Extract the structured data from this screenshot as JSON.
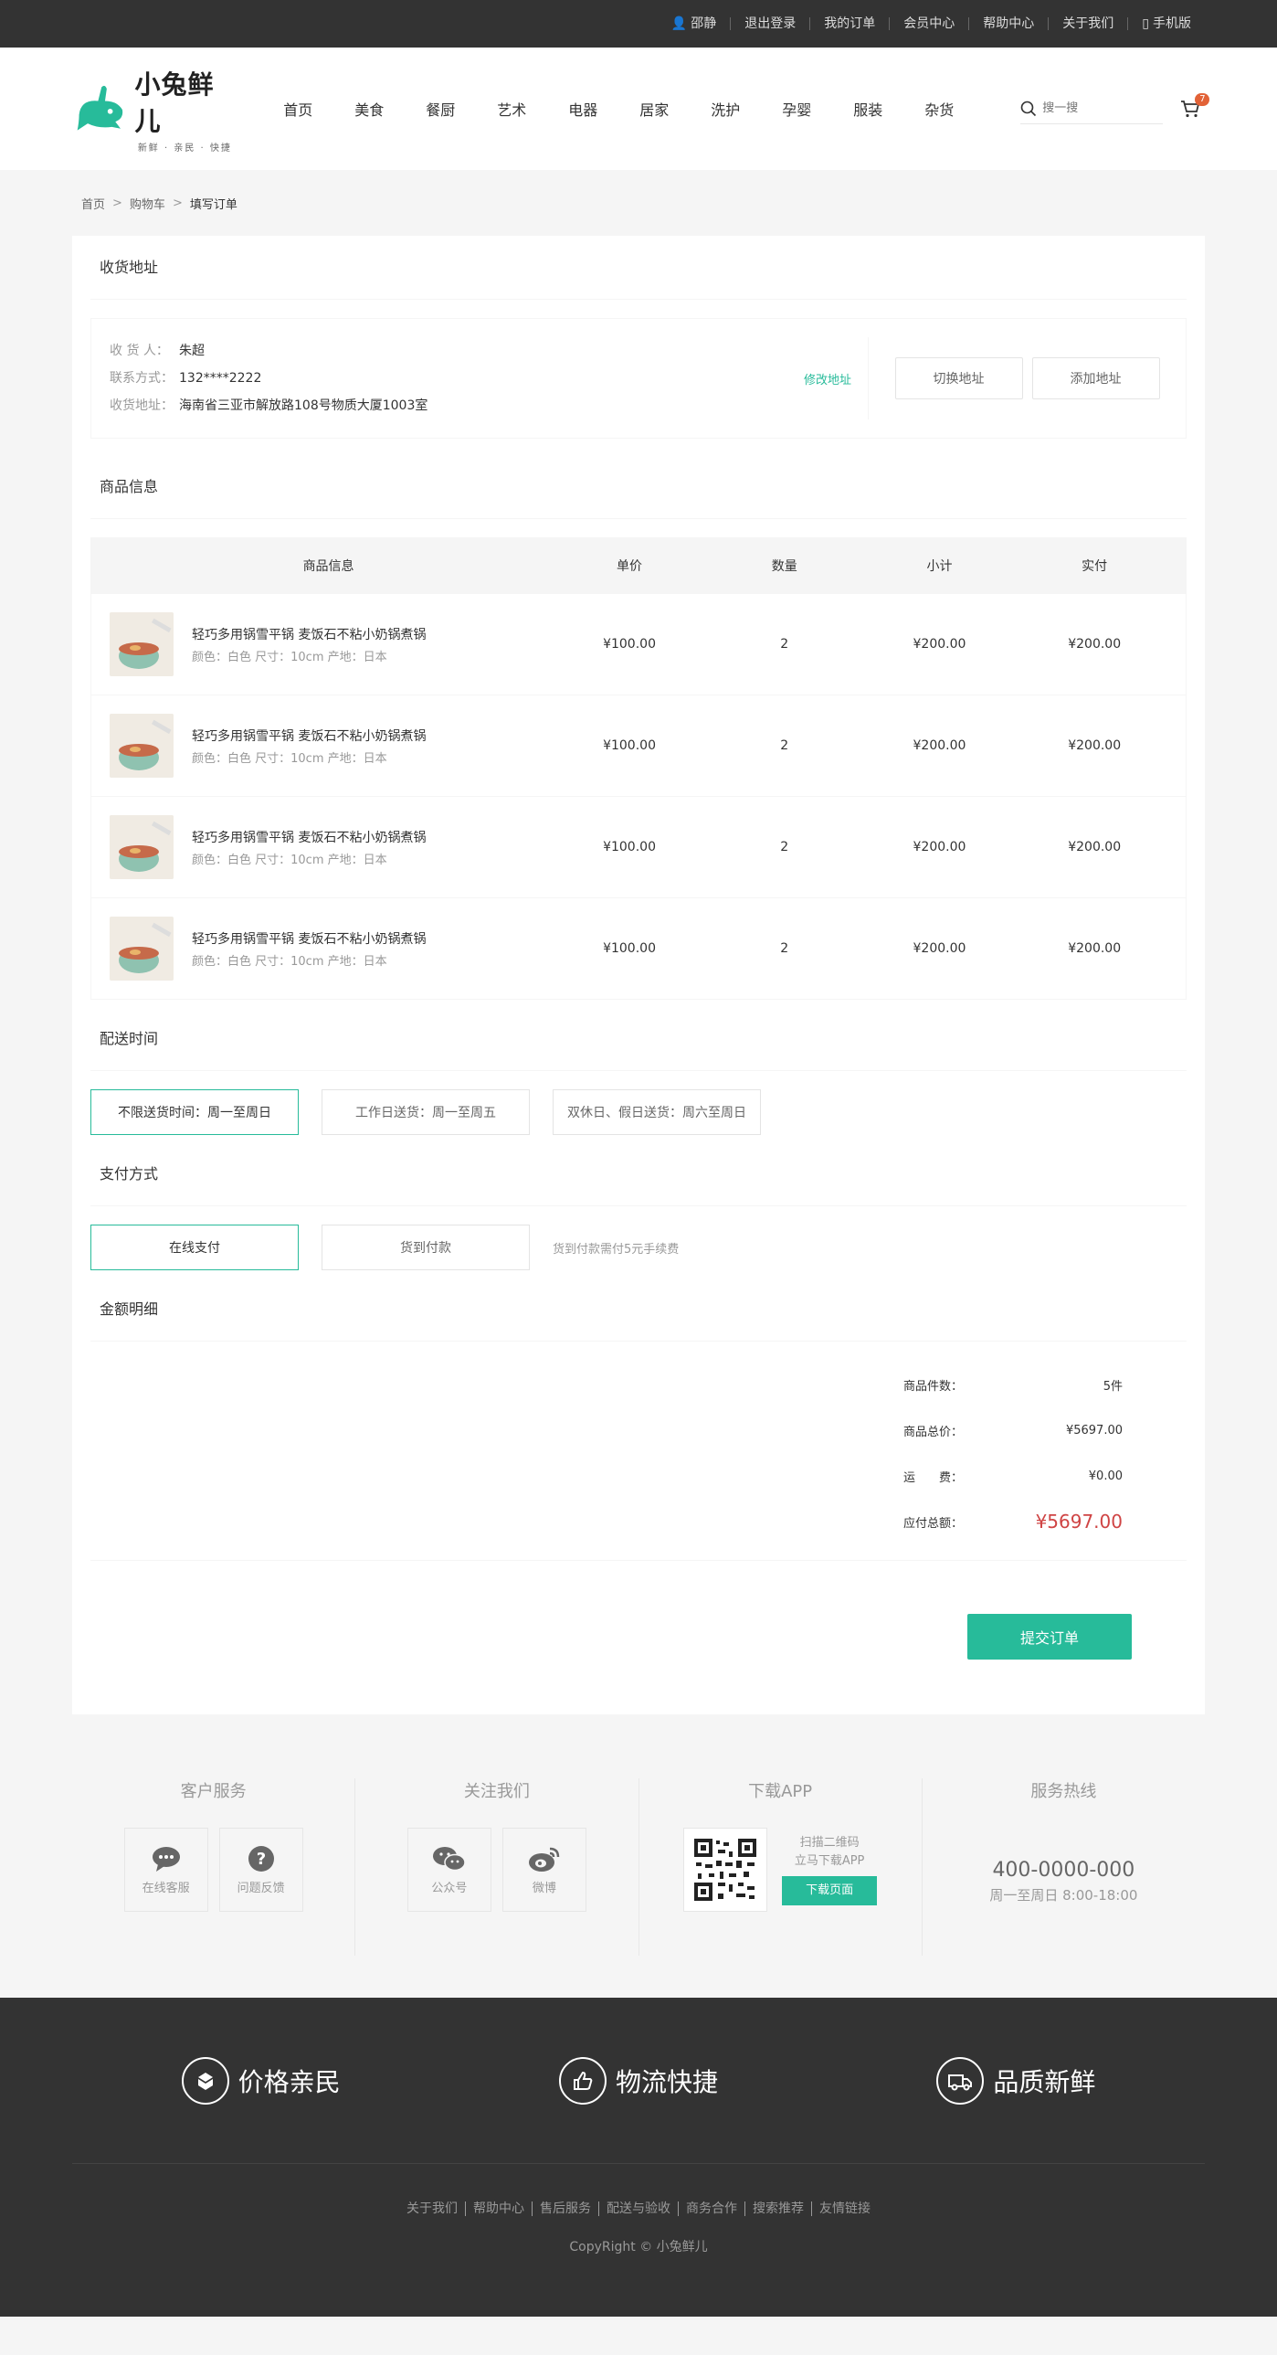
{
  "topbar": {
    "user": "邵静",
    "logout": "退出登录",
    "orders": "我的订单",
    "member": "会员中心",
    "help": "帮助中心",
    "about": "关于我们",
    "mobile": "手机版"
  },
  "logo": {
    "name": "小兔鲜儿",
    "slogan": "新鲜 · 亲民 · 快捷"
  },
  "nav": [
    "首页",
    "美食",
    "餐厨",
    "艺术",
    "电器",
    "居家",
    "洗护",
    "孕婴",
    "服装",
    "杂货"
  ],
  "search": {
    "placeholder": "搜一搜"
  },
  "cart": {
    "count": "7"
  },
  "breadcrumb": {
    "home": "首页",
    "cart": "购物车",
    "current": "填写订单"
  },
  "address": {
    "title": "收货地址",
    "receiver_label": "收 货 人：",
    "receiver": "朱超",
    "phone_label": "联系方式：",
    "phone": "132****2222",
    "addr_label": "收货地址：",
    "addr": "海南省三亚市解放路108号物质大厦1003室",
    "modify": "修改地址",
    "switch_btn": "切换地址",
    "add_btn": "添加地址"
  },
  "goods": {
    "title": "商品信息",
    "headers": [
      "商品信息",
      "单价",
      "数量",
      "小计",
      "实付"
    ],
    "rows": [
      {
        "name": "轻巧多用锅雪平锅 麦饭石不粘小奶锅煮锅",
        "attr": "颜色：白色 尺寸：10cm 产地：日本",
        "price": "¥100.00",
        "qty": "2",
        "subtotal": "¥200.00",
        "paid": "¥200.00"
      },
      {
        "name": "轻巧多用锅雪平锅 麦饭石不粘小奶锅煮锅",
        "attr": "颜色：白色 尺寸：10cm 产地：日本",
        "price": "¥100.00",
        "qty": "2",
        "subtotal": "¥200.00",
        "paid": "¥200.00"
      },
      {
        "name": "轻巧多用锅雪平锅 麦饭石不粘小奶锅煮锅",
        "attr": "颜色：白色 尺寸：10cm 产地：日本",
        "price": "¥100.00",
        "qty": "2",
        "subtotal": "¥200.00",
        "paid": "¥200.00"
      },
      {
        "name": "轻巧多用锅雪平锅 麦饭石不粘小奶锅煮锅",
        "attr": "颜色：白色 尺寸：10cm 产地：日本",
        "price": "¥100.00",
        "qty": "2",
        "subtotal": "¥200.00",
        "paid": "¥200.00"
      }
    ]
  },
  "delivery": {
    "title": "配送时间",
    "options": [
      "不限送货时间：周一至周日",
      "工作日送货：周一至周五",
      "双休日、假日送货：周六至周日"
    ]
  },
  "payment": {
    "title": "支付方式",
    "options": [
      "在线支付",
      "货到付款"
    ],
    "tip": "货到付款需付5元手续费"
  },
  "amount": {
    "title": "金额明细",
    "count_label": "商品件数：",
    "count": "5件",
    "total_label": "商品总价：",
    "total": "¥5697.00",
    "freight_label": "运　　费：",
    "freight": "¥0.00",
    "pay_label": "应付总额：",
    "pay": "¥5697.00"
  },
  "submit": "提交订单",
  "service": {
    "customer_title": "客户服务",
    "online": "在线客服",
    "feedback": "问题反馈",
    "follow_title": "关注我们",
    "wechat": "公众号",
    "weibo": "微博",
    "app_title": "下载APP",
    "scan": "扫描二维码",
    "scan2": "立马下载APP",
    "download": "下载页面",
    "hotline_title": "服务热线",
    "phone": "400-0000-000",
    "hours": "周一至周日 8:00-18:00"
  },
  "footer": {
    "features": [
      "价格亲民",
      "物流快捷",
      "品质新鲜"
    ],
    "links": [
      "关于我们",
      "帮助中心",
      "售后服务",
      "配送与验收",
      "商务合作",
      "搜索推荐",
      "友情链接"
    ],
    "copyright": "CopyRight © 小兔鲜儿"
  },
  "colors": {
    "accent": "#27bb9a",
    "price_red": "#cf4444",
    "dark": "#333333",
    "badge": "#e26237"
  }
}
